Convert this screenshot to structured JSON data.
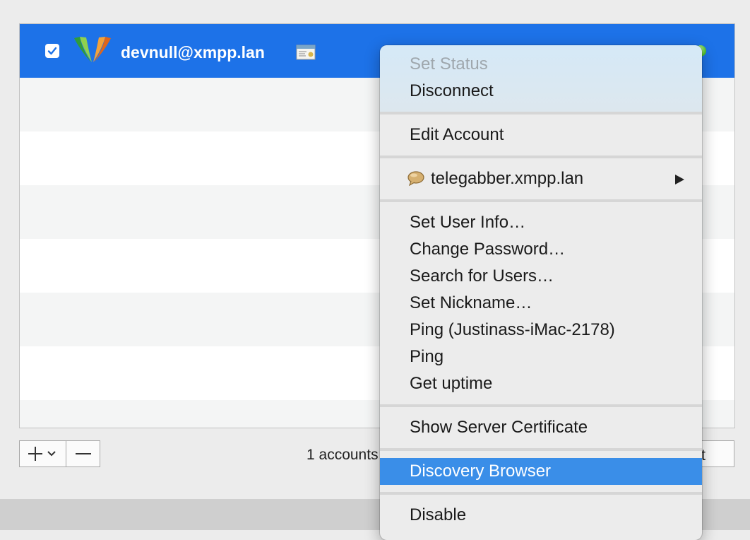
{
  "account": {
    "name": "devnull@xmpp.lan",
    "enabled": true,
    "status_color": "#4fbf2a"
  },
  "footer": {
    "add_symbol": "+",
    "remove_symbol": "—",
    "accounts_count": "1 accounts",
    "edit_label": "it"
  },
  "context_menu": {
    "set_status": "Set Status",
    "disconnect": "Disconnect",
    "edit_account": "Edit Account",
    "server_item": "telegabber.xmpp.lan",
    "set_user_info": "Set User Info…",
    "change_password": "Change Password…",
    "search_users": "Search for Users…",
    "set_nickname": "Set Nickname…",
    "ping_host": "Ping (Justinass-iMac-2178)",
    "ping": "Ping",
    "get_uptime": "Get uptime",
    "show_certificate": "Show Server Certificate",
    "discovery_browser": "Discovery Browser",
    "disable": "Disable"
  },
  "colors": {
    "selection": "#1d72e8",
    "menu_highlight": "#3a8ee8"
  },
  "icons": {
    "service": "xmpp-logo-icon",
    "certificate": "certificate-icon",
    "server": "server-bubble-icon",
    "submenu": "chevron-right-icon"
  }
}
